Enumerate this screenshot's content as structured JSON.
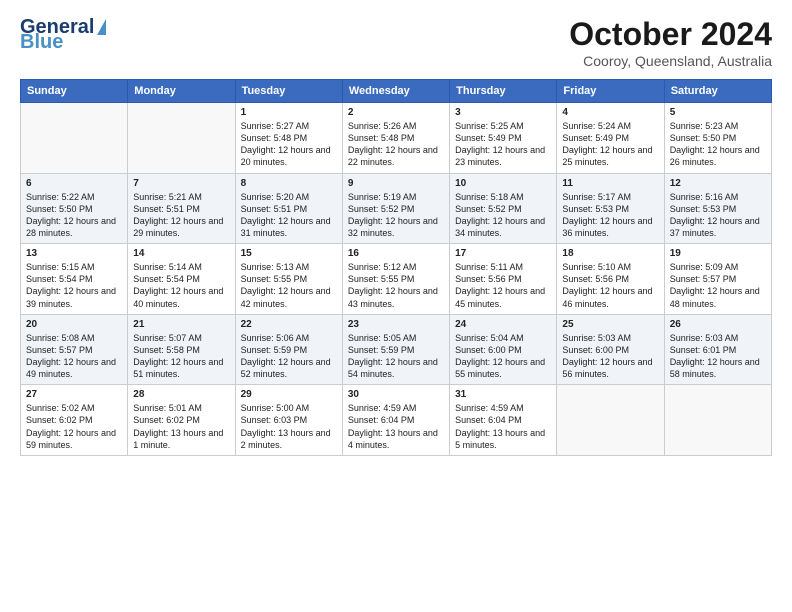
{
  "header": {
    "logo_general": "General",
    "logo_blue": "Blue",
    "month": "October 2024",
    "location": "Cooroy, Queensland, Australia"
  },
  "weekdays": [
    "Sunday",
    "Monday",
    "Tuesday",
    "Wednesday",
    "Thursday",
    "Friday",
    "Saturday"
  ],
  "weeks": [
    [
      {
        "day": "",
        "content": ""
      },
      {
        "day": "",
        "content": ""
      },
      {
        "day": "1",
        "content": "Sunrise: 5:27 AM\nSunset: 5:48 PM\nDaylight: 12 hours and 20 minutes."
      },
      {
        "day": "2",
        "content": "Sunrise: 5:26 AM\nSunset: 5:48 PM\nDaylight: 12 hours and 22 minutes."
      },
      {
        "day": "3",
        "content": "Sunrise: 5:25 AM\nSunset: 5:49 PM\nDaylight: 12 hours and 23 minutes."
      },
      {
        "day": "4",
        "content": "Sunrise: 5:24 AM\nSunset: 5:49 PM\nDaylight: 12 hours and 25 minutes."
      },
      {
        "day": "5",
        "content": "Sunrise: 5:23 AM\nSunset: 5:50 PM\nDaylight: 12 hours and 26 minutes."
      }
    ],
    [
      {
        "day": "6",
        "content": "Sunrise: 5:22 AM\nSunset: 5:50 PM\nDaylight: 12 hours and 28 minutes."
      },
      {
        "day": "7",
        "content": "Sunrise: 5:21 AM\nSunset: 5:51 PM\nDaylight: 12 hours and 29 minutes."
      },
      {
        "day": "8",
        "content": "Sunrise: 5:20 AM\nSunset: 5:51 PM\nDaylight: 12 hours and 31 minutes."
      },
      {
        "day": "9",
        "content": "Sunrise: 5:19 AM\nSunset: 5:52 PM\nDaylight: 12 hours and 32 minutes."
      },
      {
        "day": "10",
        "content": "Sunrise: 5:18 AM\nSunset: 5:52 PM\nDaylight: 12 hours and 34 minutes."
      },
      {
        "day": "11",
        "content": "Sunrise: 5:17 AM\nSunset: 5:53 PM\nDaylight: 12 hours and 36 minutes."
      },
      {
        "day": "12",
        "content": "Sunrise: 5:16 AM\nSunset: 5:53 PM\nDaylight: 12 hours and 37 minutes."
      }
    ],
    [
      {
        "day": "13",
        "content": "Sunrise: 5:15 AM\nSunset: 5:54 PM\nDaylight: 12 hours and 39 minutes."
      },
      {
        "day": "14",
        "content": "Sunrise: 5:14 AM\nSunset: 5:54 PM\nDaylight: 12 hours and 40 minutes."
      },
      {
        "day": "15",
        "content": "Sunrise: 5:13 AM\nSunset: 5:55 PM\nDaylight: 12 hours and 42 minutes."
      },
      {
        "day": "16",
        "content": "Sunrise: 5:12 AM\nSunset: 5:55 PM\nDaylight: 12 hours and 43 minutes."
      },
      {
        "day": "17",
        "content": "Sunrise: 5:11 AM\nSunset: 5:56 PM\nDaylight: 12 hours and 45 minutes."
      },
      {
        "day": "18",
        "content": "Sunrise: 5:10 AM\nSunset: 5:56 PM\nDaylight: 12 hours and 46 minutes."
      },
      {
        "day": "19",
        "content": "Sunrise: 5:09 AM\nSunset: 5:57 PM\nDaylight: 12 hours and 48 minutes."
      }
    ],
    [
      {
        "day": "20",
        "content": "Sunrise: 5:08 AM\nSunset: 5:57 PM\nDaylight: 12 hours and 49 minutes."
      },
      {
        "day": "21",
        "content": "Sunrise: 5:07 AM\nSunset: 5:58 PM\nDaylight: 12 hours and 51 minutes."
      },
      {
        "day": "22",
        "content": "Sunrise: 5:06 AM\nSunset: 5:59 PM\nDaylight: 12 hours and 52 minutes."
      },
      {
        "day": "23",
        "content": "Sunrise: 5:05 AM\nSunset: 5:59 PM\nDaylight: 12 hours and 54 minutes."
      },
      {
        "day": "24",
        "content": "Sunrise: 5:04 AM\nSunset: 6:00 PM\nDaylight: 12 hours and 55 minutes."
      },
      {
        "day": "25",
        "content": "Sunrise: 5:03 AM\nSunset: 6:00 PM\nDaylight: 12 hours and 56 minutes."
      },
      {
        "day": "26",
        "content": "Sunrise: 5:03 AM\nSunset: 6:01 PM\nDaylight: 12 hours and 58 minutes."
      }
    ],
    [
      {
        "day": "27",
        "content": "Sunrise: 5:02 AM\nSunset: 6:02 PM\nDaylight: 12 hours and 59 minutes."
      },
      {
        "day": "28",
        "content": "Sunrise: 5:01 AM\nSunset: 6:02 PM\nDaylight: 13 hours and 1 minute."
      },
      {
        "day": "29",
        "content": "Sunrise: 5:00 AM\nSunset: 6:03 PM\nDaylight: 13 hours and 2 minutes."
      },
      {
        "day": "30",
        "content": "Sunrise: 4:59 AM\nSunset: 6:04 PM\nDaylight: 13 hours and 4 minutes."
      },
      {
        "day": "31",
        "content": "Sunrise: 4:59 AM\nSunset: 6:04 PM\nDaylight: 13 hours and 5 minutes."
      },
      {
        "day": "",
        "content": ""
      },
      {
        "day": "",
        "content": ""
      }
    ]
  ]
}
